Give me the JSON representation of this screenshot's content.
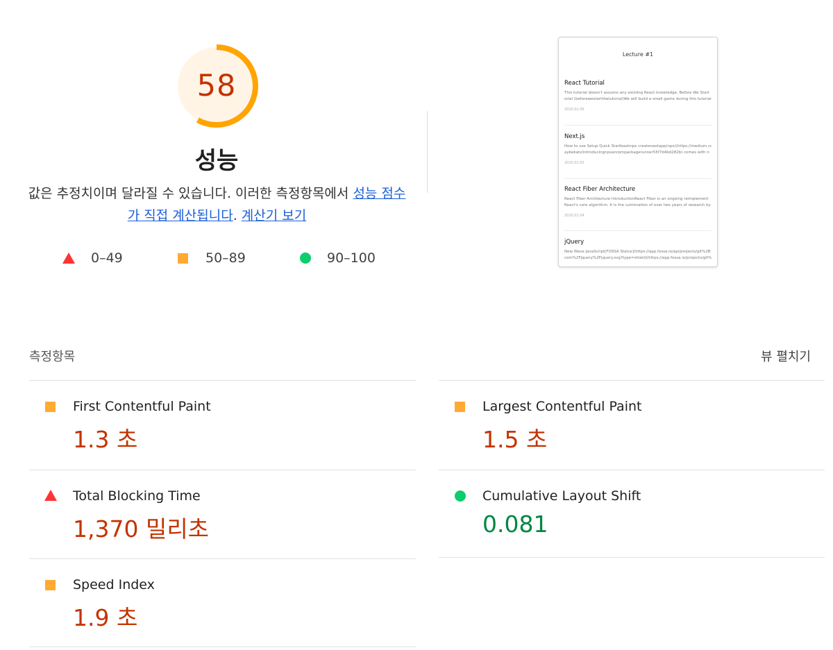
{
  "score": {
    "value": "58",
    "fraction": 0.58,
    "title": "성능",
    "ring_color": "#ffa400",
    "ring_bg_color": "#fff3e0",
    "text_color": "#c33300"
  },
  "description": {
    "text_before": "값은 추정치이며 달라질 수 있습니다. 이러한 측정항목에서 ",
    "link_score": "성능 점수가 직접 계산됩니다",
    "text_middle": ". ",
    "link_calculator": "계산기 보기"
  },
  "legend": [
    {
      "icon": "fail-triangle-icon",
      "label": "0–49",
      "color": "#ff3333"
    },
    {
      "icon": "average-square-icon",
      "label": "50–89",
      "color": "#ffaa33"
    },
    {
      "icon": "pass-circle-icon",
      "label": "90–100",
      "color": "#0cce6b"
    }
  ],
  "thumbnail": {
    "header": "Lecture #1",
    "posts": [
      {
        "title": "React Tutorial",
        "body_line1": "This tutorial doesn't assume any existing React knowledge. Before We Start",
        "body_line2": "orial (beforewestartthetutorial)We will build a small game during this tutorial",
        "date": "2020.01.06"
      },
      {
        "title": "Next.js",
        "body_line1": "How to use Setup Quick Startbashnpx createnextapp(npx)(https://medium.co",
        "body_line2": "aybekatz/introducingnpxanrpmpackagerunner55f7d4bd282b) comes with n",
        "date": "2020.01.05"
      },
      {
        "title": "React Fiber Architecture",
        "body_line1": "React Fiber Architecture IntroductionReact Fiber is an ongoing reimplement",
        "body_line2": "React's core algorithm. It is the culmination of over two years of research by",
        "date": "2020.01.04"
      },
      {
        "title": "jQuery",
        "body_line1": "New Wave JavaScript[FOSSA Status](https://app.fossa.io/api/projects/git%2B",
        "body_line2": "com%2Fjquery%2Fjquery.svg?type=shield)(https://app.fossa.io/projects/git%",
        "date": ""
      }
    ]
  },
  "metrics": {
    "title": "측정항목",
    "expand_label": "뷰 펼치기",
    "items": [
      {
        "name": "First Contentful Paint",
        "value": "1.3 초",
        "rating": "average"
      },
      {
        "name": "Largest Contentful Paint",
        "value": "1.5 초",
        "rating": "average"
      },
      {
        "name": "Total Blocking Time",
        "value": "1,370 밀리초",
        "rating": "fail"
      },
      {
        "name": "Cumulative Layout Shift",
        "value": "0.081",
        "rating": "pass"
      },
      {
        "name": "Speed Index",
        "value": "1.9 초",
        "rating": "average"
      }
    ]
  }
}
